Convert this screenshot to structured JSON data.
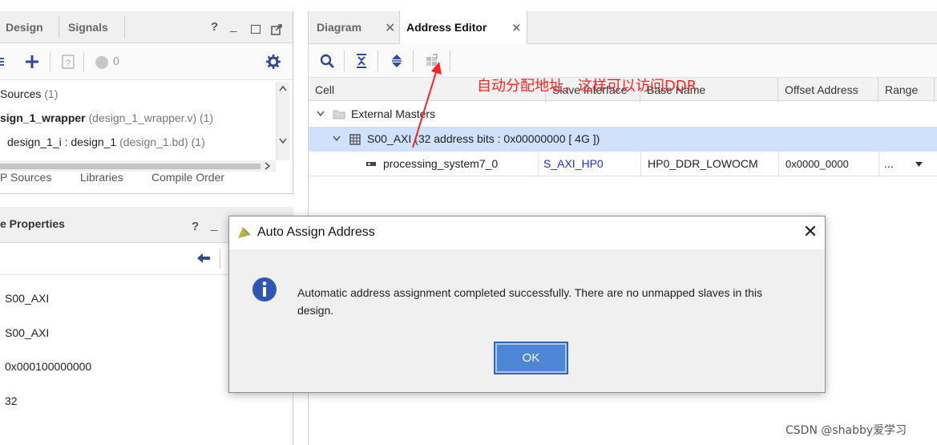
{
  "left_top": {
    "tabs": [
      "Design",
      "Signals"
    ],
    "toolbar_count": "0",
    "tree": {
      "sources_label": "Sources",
      "sources_count": "(1)",
      "wrapper_name": "sign_1_wrapper",
      "wrapper_file": "(design_1_wrapper.v) (1)",
      "child_name": "design_1_i : design_1",
      "child_file": "(design_1.bd) (1)"
    },
    "bottom_tabs": [
      "P Sources",
      "Libraries",
      "Compile Order"
    ]
  },
  "left_bottom": {
    "title": "e Properties",
    "values": [
      "S00_AXI",
      "S00_AXI",
      "0x000100000000",
      "32"
    ]
  },
  "right": {
    "tabs": [
      "Diagram",
      "Address Editor"
    ],
    "columns": [
      "Cell",
      "Slave Interface",
      "Base Name",
      "Offset Address",
      "Range"
    ],
    "rows": {
      "external_masters": "External Masters",
      "s00_axi": "S00_AXI (32 address bits : 0x00000000 [ 4G ])",
      "cell": "processing_system7_0",
      "slave_interface": "S_AXI_HP0",
      "base_name": "HP0_DDR_LOWOCM",
      "offset": "0x0000_0000",
      "range": "..."
    },
    "annotation": "自动分配地址，这样可以访问DDR"
  },
  "dialog": {
    "title": "Auto Assign Address",
    "message": "Automatic address assignment completed successfully. There are no unmapped slaves in this design.",
    "ok_label": "OK",
    "close_glyph": "✕"
  },
  "watermark": "CSDN @shabby爱学习",
  "colors": {
    "accent_blue": "#4d86d4",
    "selected_row": "#cfe1fb",
    "annotation_red": "#ff2222",
    "link_blue": "#1f2fd0"
  },
  "icons": {
    "toolbar_left": [
      "expand-all-icon",
      "add-icon",
      "help-box-icon",
      "status-dot-icon",
      "gear-icon"
    ],
    "toolbar_right": [
      "search-icon",
      "collapse-all-icon",
      "expand-all-icon",
      "auto-assign-icon"
    ]
  }
}
